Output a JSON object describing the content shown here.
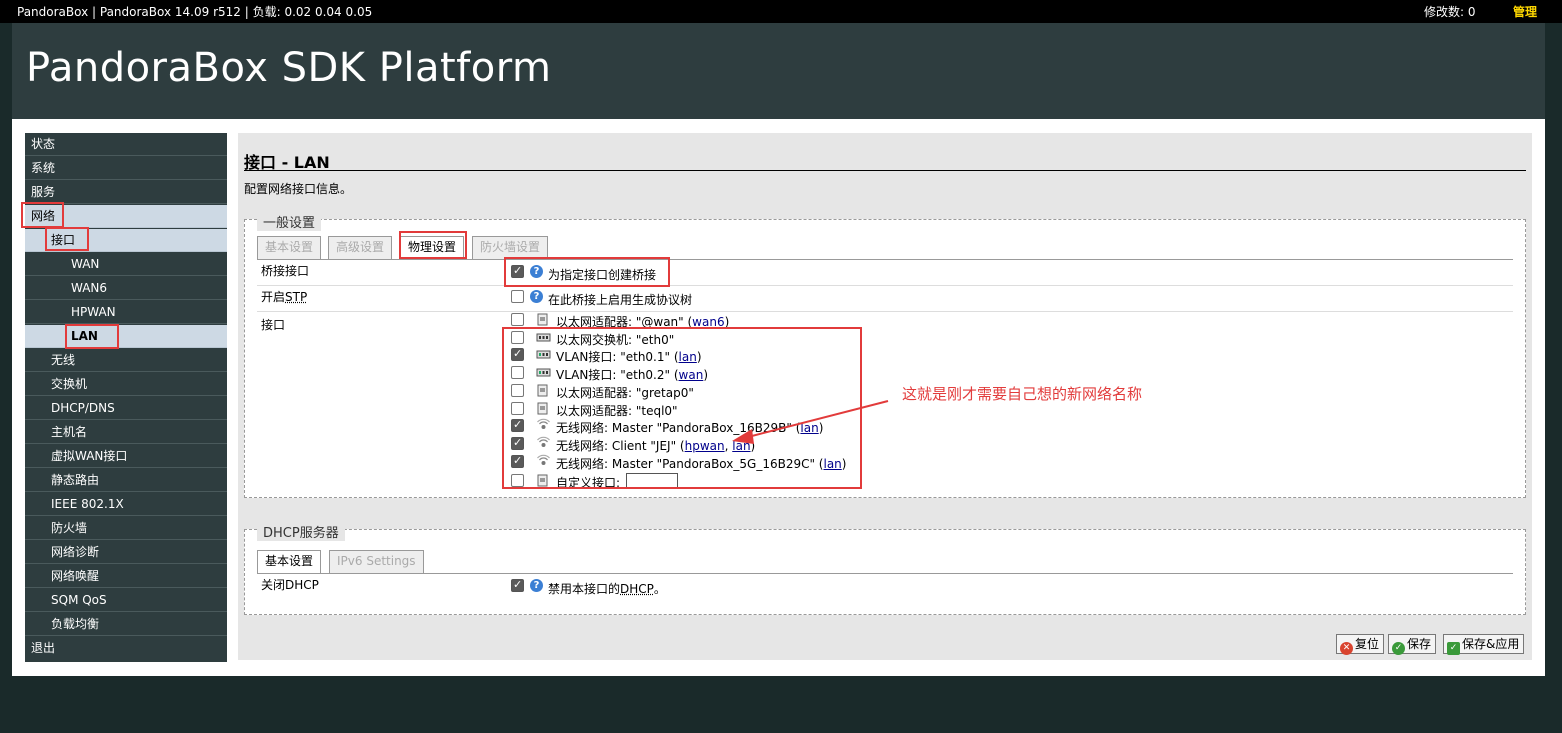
{
  "topbar": {
    "title": "PandoraBox | PandoraBox 14.09 r512 | 负载: 0.02 0.04 0.05",
    "changes": "修改数: 0",
    "admin": "管理"
  },
  "header": {
    "brand": "PandoraBox SDK Platform"
  },
  "sidebar": {
    "status": "状态",
    "system": "系统",
    "services": "服务",
    "network": "网络",
    "interfaces": "接口",
    "wan": "WAN",
    "wan6": "WAN6",
    "hpwan": "HPWAN",
    "lan": "LAN",
    "wireless": "无线",
    "switch": "交换机",
    "dhcp_dns": "DHCP/DNS",
    "hostnames": "主机名",
    "vwan": "虚拟WAN接口",
    "routes": "静态路由",
    "ieee": "IEEE 802.1X",
    "firewall": "防火墙",
    "diagnostics": "网络诊断",
    "wol": "网络唤醒",
    "sqm": "SQM QoS",
    "mwan": "负载均衡",
    "logout": "退出"
  },
  "page": {
    "title": "接口 - LAN",
    "description": "配置网络接口信息。"
  },
  "general": {
    "legend": "一般设置",
    "tabs": [
      "基本设置",
      "高级设置",
      "物理设置",
      "防火墙设置"
    ],
    "selected_tab": "物理设置",
    "bridge": {
      "label": "桥接接口",
      "desc": "为指定接口创建桥接",
      "checked": true
    },
    "stp": {
      "label_prefix": "开启",
      "label_link": "STP",
      "desc": "在此桥接上启用生成协议树",
      "checked": false
    },
    "iface": {
      "label": "接口",
      "items": [
        {
          "text": "以太网适配器: \"@wan\" (",
          "link1": "wan6",
          "sep": "",
          "link2": "",
          "end": ")",
          "checked": false,
          "icon": "ethernet-adapter-icon"
        },
        {
          "text": "以太网交换机: \"eth0\"",
          "link1": "",
          "sep": "",
          "link2": "",
          "end": "",
          "checked": false,
          "icon": "switch-icon"
        },
        {
          "text": "VLAN接口: \"eth0.1\" (",
          "link1": "lan",
          "sep": "",
          "link2": "",
          "end": ")",
          "checked": true,
          "icon": "vlan-icon"
        },
        {
          "text": "VLAN接口: \"eth0.2\" (",
          "link1": "wan",
          "sep": "",
          "link2": "",
          "end": ")",
          "checked": false,
          "icon": "vlan-icon"
        },
        {
          "text": "以太网适配器: \"gretap0\"",
          "link1": "",
          "sep": "",
          "link2": "",
          "end": "",
          "checked": false,
          "icon": "ethernet-adapter-icon"
        },
        {
          "text": "以太网适配器: \"teql0\"",
          "link1": "",
          "sep": "",
          "link2": "",
          "end": "",
          "checked": false,
          "icon": "ethernet-adapter-icon"
        },
        {
          "text": "无线网络: Master \"PandoraBox_16B29B\" (",
          "link1": "lan",
          "sep": "",
          "link2": "",
          "end": ")",
          "checked": true,
          "icon": "wireless-icon"
        },
        {
          "text": "无线网络: Client \"JEJ\" (",
          "link1": "hpwan",
          "sep": ", ",
          "link2": "lan",
          "end": ")",
          "checked": true,
          "icon": "wireless-icon"
        },
        {
          "text": "无线网络: Master \"PandoraBox_5G_16B29C\" (",
          "link1": "lan",
          "sep": "",
          "link2": "",
          "end": ")",
          "checked": true,
          "icon": "wireless-icon"
        }
      ],
      "custom_label": "自定义接口:",
      "custom_value": ""
    }
  },
  "annotation": {
    "text": "这就是刚才需要自己想的新网络名称"
  },
  "dhcp": {
    "legend": "DHCP服务器",
    "tabs": [
      "基本设置",
      "IPv6 Settings"
    ],
    "disable": {
      "label": "关闭DHCP",
      "desc_prefix": "禁用本接口的",
      "desc_link": "DHCP",
      "desc_suffix": "。",
      "checked": true
    }
  },
  "buttons": {
    "reset": "复位",
    "save": "保存",
    "apply": "保存&应用"
  },
  "colors": {
    "accent_red": "#e23b3b",
    "nav_bg": "#2e3d3f",
    "nav_active": "#cdd9e4",
    "admin_yellow": "#ffd800"
  }
}
